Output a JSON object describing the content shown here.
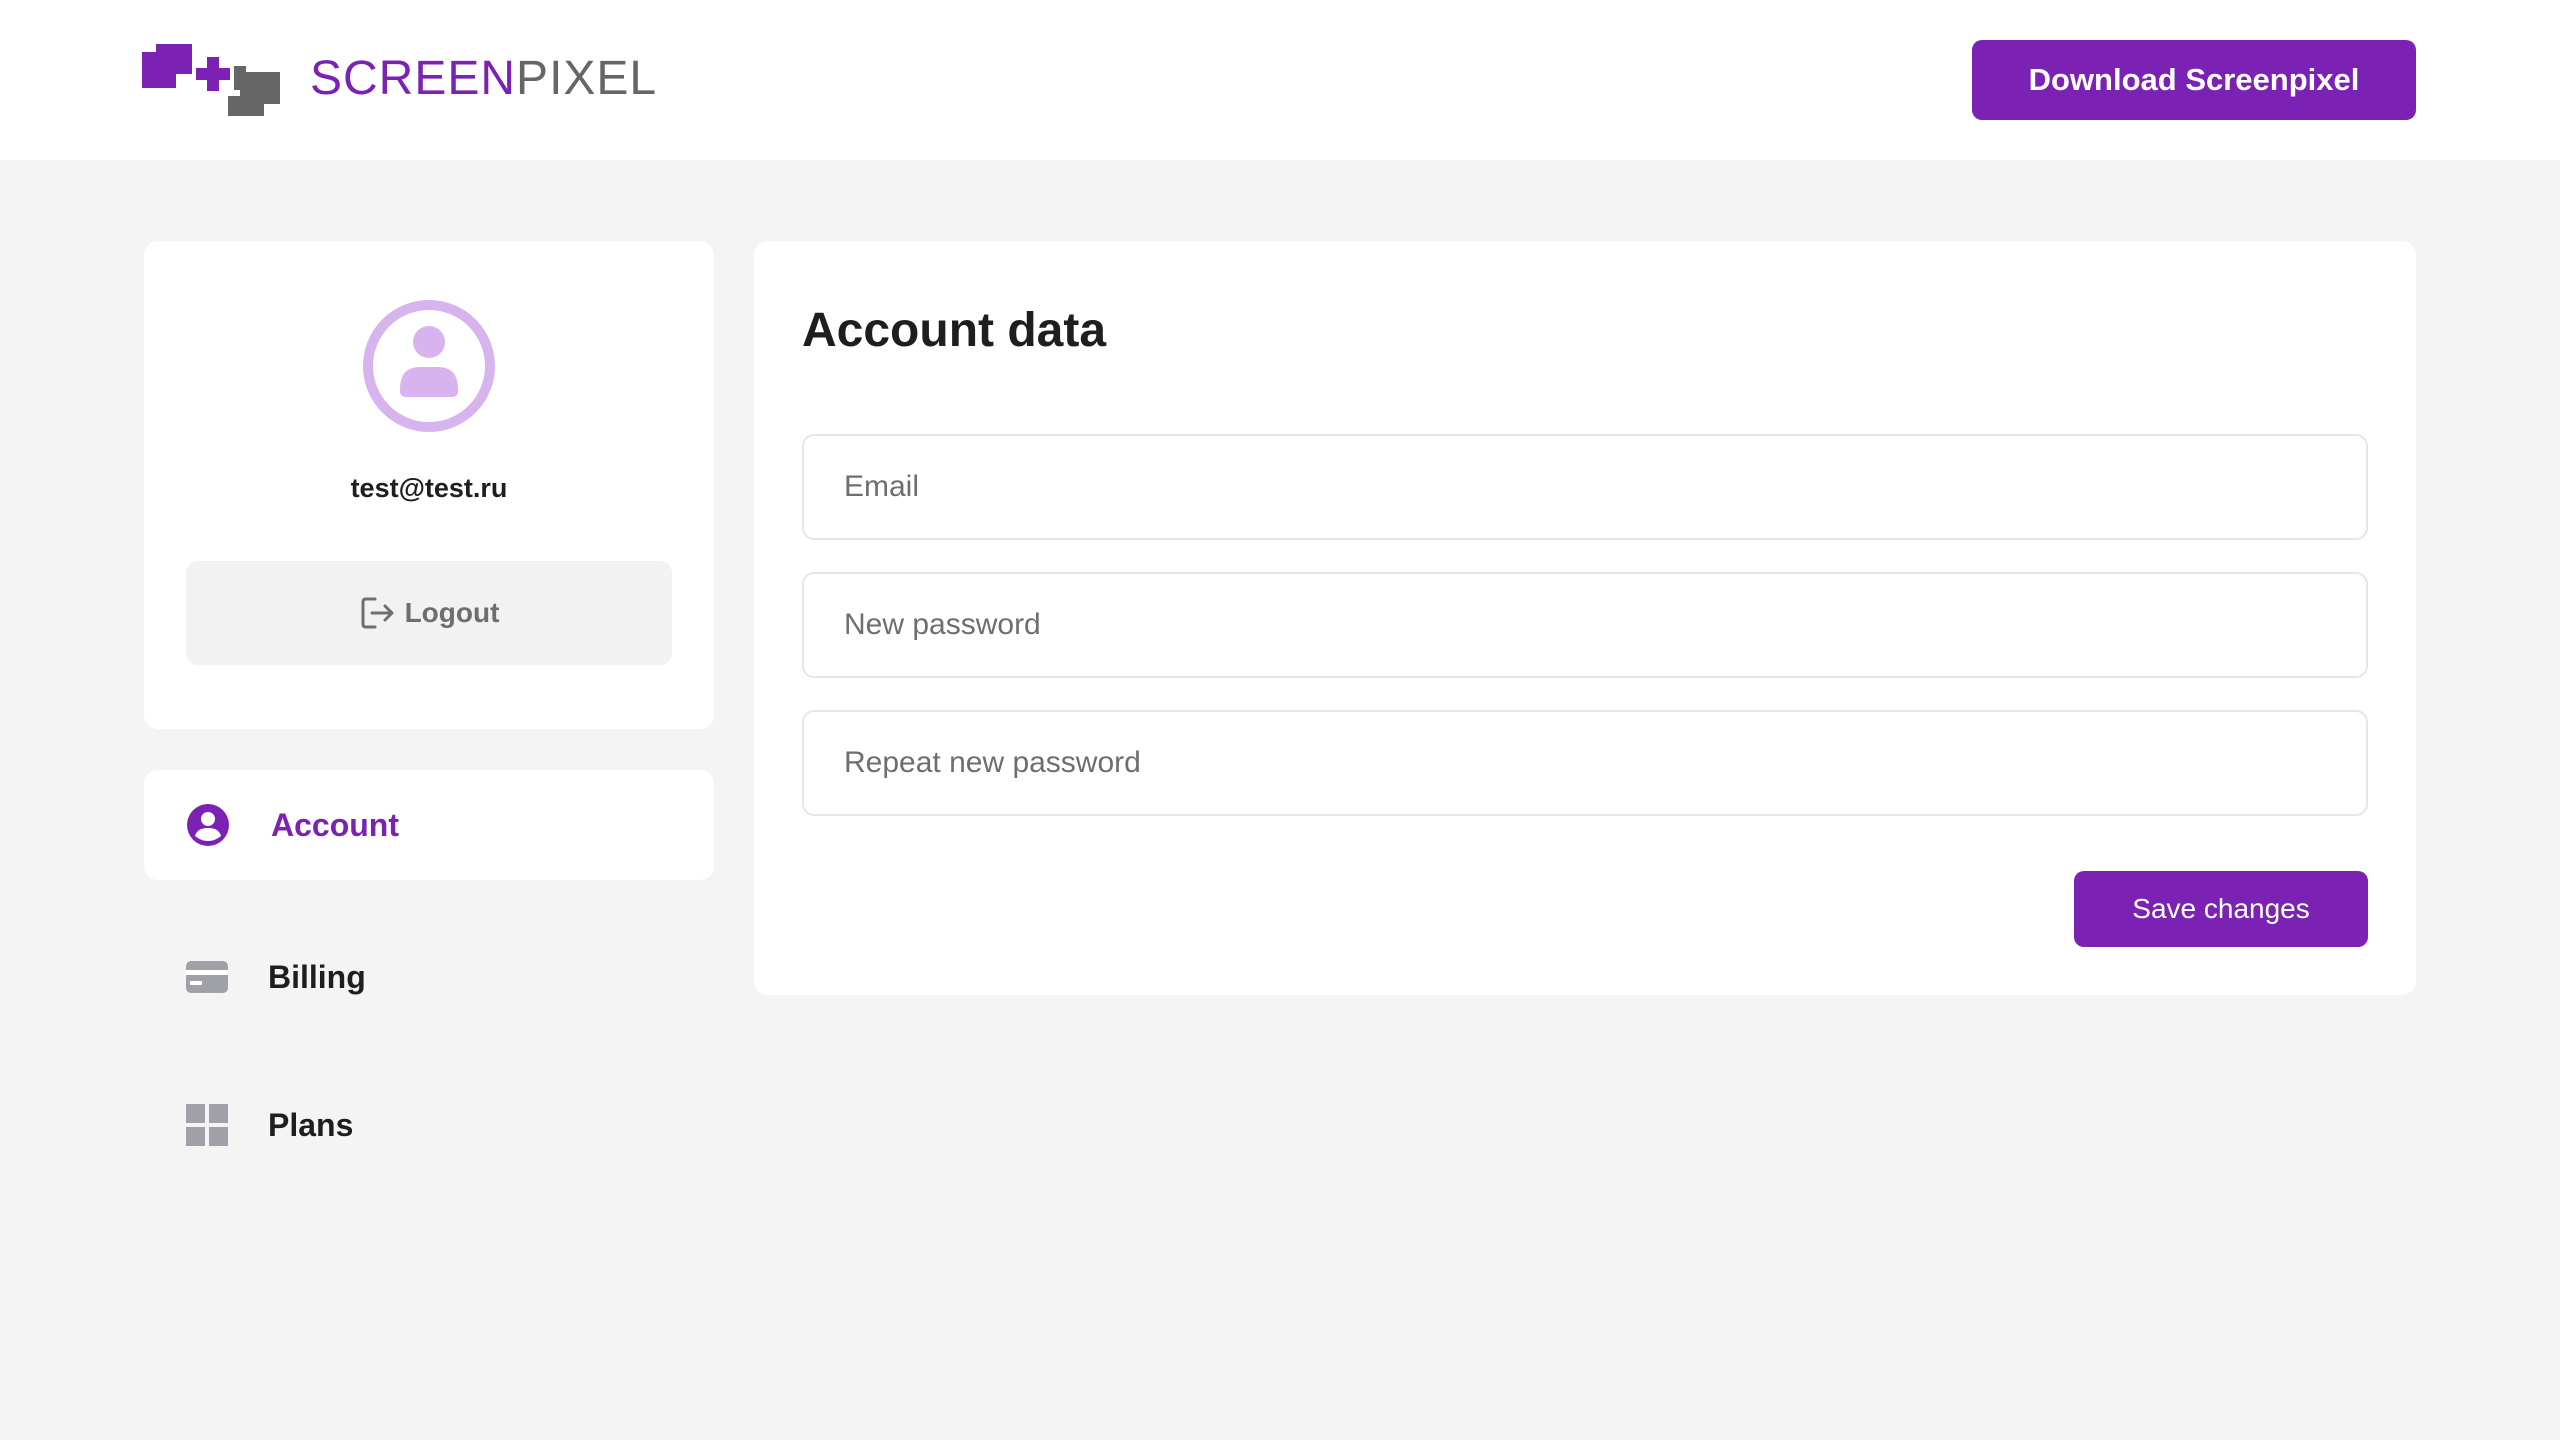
{
  "brand": {
    "name_part1": "SCREEN",
    "name_part2": "PIXEL",
    "logo_icon": "screenpixel-logo-icon",
    "colors": {
      "primary": "#7b22b4",
      "gray": "#666666"
    }
  },
  "header": {
    "download_label": "Download Screenpixel"
  },
  "profile": {
    "avatar_icon": "user-circle-icon",
    "email": "test@test.ru",
    "logout_label": "Logout",
    "logout_icon": "logout-icon"
  },
  "nav": {
    "items": [
      {
        "label": "Account",
        "icon": "user-circle-icon",
        "active": true
      },
      {
        "label": "Billing",
        "icon": "credit-card-icon",
        "active": false
      },
      {
        "label": "Plans",
        "icon": "grid-icon",
        "active": false
      }
    ]
  },
  "account": {
    "title": "Account data",
    "fields": [
      {
        "placeholder": "Email",
        "value": ""
      },
      {
        "placeholder": "New password",
        "value": ""
      },
      {
        "placeholder": "Repeat new password",
        "value": ""
      }
    ],
    "save_label": "Save changes"
  }
}
